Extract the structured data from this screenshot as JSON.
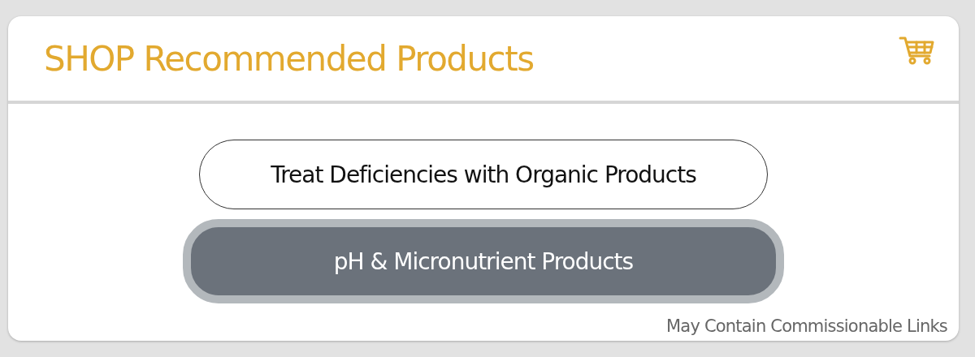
{
  "header": {
    "title": "SHOP Recommended Products"
  },
  "buttons": [
    {
      "label": "Treat Deficiencies with Organic Products",
      "selected": false
    },
    {
      "label": "pH & Micronutrient Products",
      "selected": true
    }
  ],
  "footnote": "May Contain Commissionable Links"
}
